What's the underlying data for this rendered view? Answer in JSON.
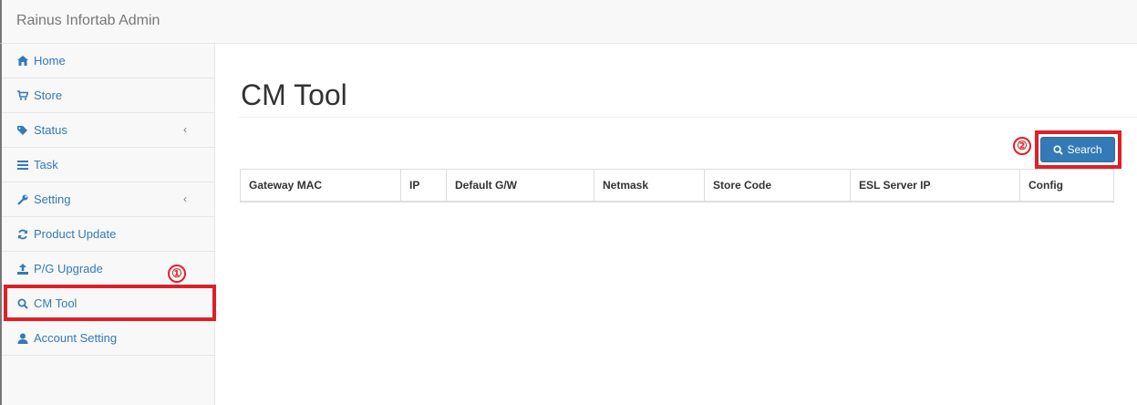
{
  "app": {
    "title": "Rainus Infortab Admin"
  },
  "sidebar": {
    "items": [
      {
        "label": "Home",
        "icon": "home-icon"
      },
      {
        "label": "Store",
        "icon": "cart-icon"
      },
      {
        "label": "Status",
        "icon": "tags-icon",
        "chevron": "‹"
      },
      {
        "label": "Task",
        "icon": "list-icon"
      },
      {
        "label": "Setting",
        "icon": "wrench-icon",
        "chevron": "‹"
      },
      {
        "label": "Product Update",
        "icon": "refresh-icon"
      },
      {
        "label": "P/G Upgrade",
        "icon": "upload-icon"
      },
      {
        "label": "CM Tool",
        "icon": "search-icon"
      },
      {
        "label": "Account Setting",
        "icon": "user-icon"
      }
    ]
  },
  "main": {
    "title": "CM Tool",
    "search_label": "Search",
    "table": {
      "columns": [
        "Gateway MAC",
        "IP",
        "Default G/W",
        "Netmask",
        "Store Code",
        "ESL Server IP",
        "Config"
      ]
    }
  },
  "annotations": {
    "marker1": "①",
    "marker2": "②"
  },
  "colors": {
    "accent": "#337ab7",
    "highlight": "#e02027"
  }
}
